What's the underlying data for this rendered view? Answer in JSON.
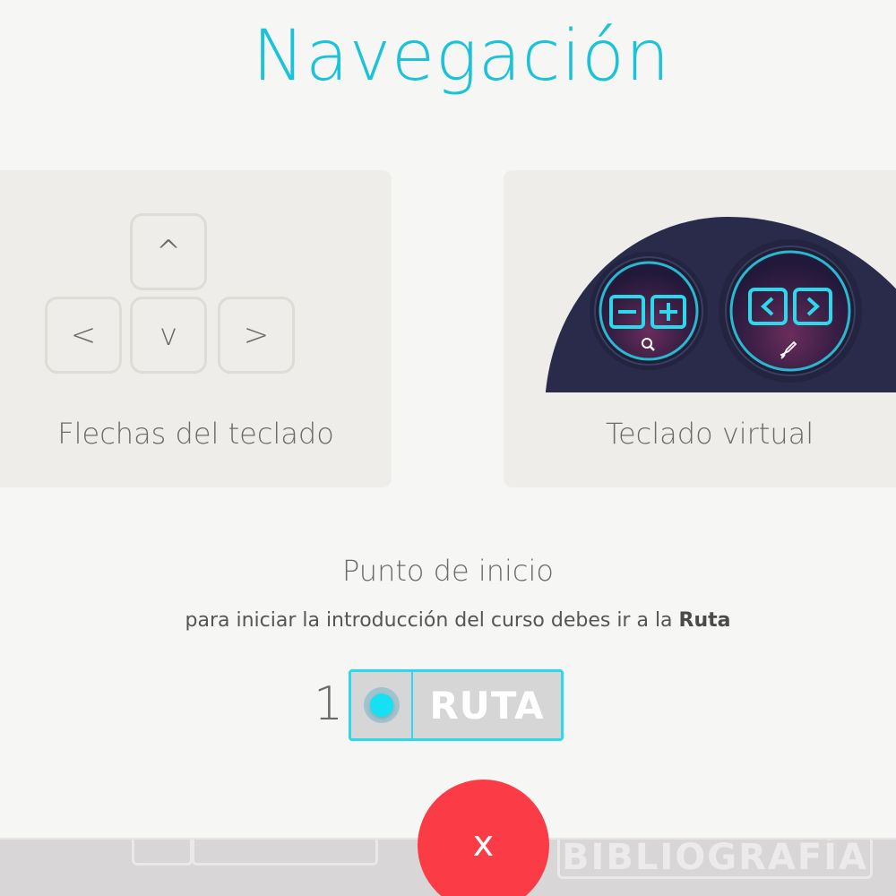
{
  "title": "Navegación",
  "colors": {
    "accent": "#1cc3d8",
    "close": "#fb3c46",
    "route_border": "#2bd8ec"
  },
  "cards": {
    "keyboard_arrows": {
      "label": "Flechas del teclado",
      "keys": {
        "up": "^",
        "left": "<",
        "down": "v",
        "right": ">"
      }
    },
    "virtual_keyboard": {
      "label": "Teclado virtual",
      "icons": [
        "minus-icon",
        "plus-icon",
        "search-icon",
        "chevron-left-icon",
        "chevron-right-icon",
        "rocket-icon"
      ]
    }
  },
  "start": {
    "title": "Punto de inicio",
    "subtitle_prefix": "para iniciar la introducción del curso debes ir a la ",
    "subtitle_bold": "Ruta"
  },
  "route": {
    "number": "1",
    "label": "RUTA"
  },
  "close_button": {
    "label": "x"
  },
  "background": {
    "bibliography_label": "BIBLIOGRAFÍA"
  }
}
